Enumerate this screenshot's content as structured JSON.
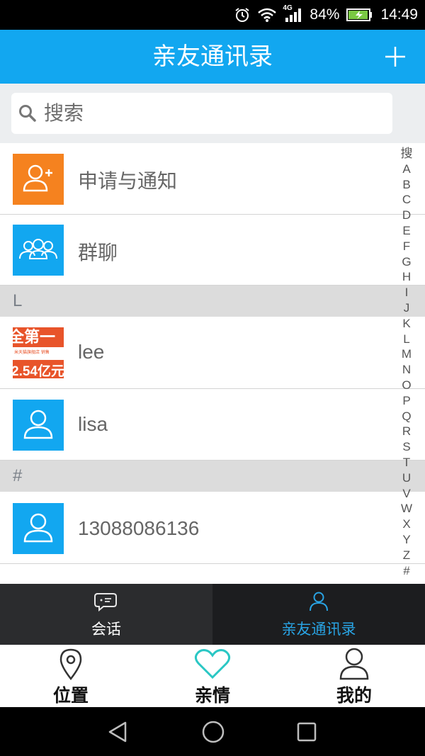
{
  "status_bar": {
    "network": "4G",
    "battery_percent": "84%",
    "time": "14:49"
  },
  "header": {
    "title": "亲友通讯录"
  },
  "search": {
    "placeholder": "搜索"
  },
  "items": [
    {
      "label": "申请与通知"
    },
    {
      "label": "群聊"
    }
  ],
  "sections": [
    {
      "letter": "L",
      "contacts": [
        {
          "name": "lee"
        },
        {
          "name": "lisa"
        }
      ]
    },
    {
      "letter": "#",
      "contacts": [
        {
          "name": "13088086136"
        }
      ]
    }
  ],
  "avatar_thumbnail": {
    "line1": "全第一",
    "line2": "米天猫旗舰店 销售",
    "line3": "2.54亿元"
  },
  "alphabet": [
    "搜",
    "A",
    "B",
    "C",
    "D",
    "E",
    "F",
    "G",
    "H",
    "I",
    "J",
    "K",
    "L",
    "M",
    "N",
    "O",
    "P",
    "Q",
    "R",
    "S",
    "T",
    "U",
    "V",
    "W",
    "X",
    "Y",
    "Z",
    "#"
  ],
  "tabs": [
    {
      "label": "会话"
    },
    {
      "label": "亲友通讯录"
    }
  ],
  "bottom_nav": [
    {
      "label": "位置"
    },
    {
      "label": "亲情"
    },
    {
      "label": "我的"
    }
  ],
  "colors": {
    "accent": "#12a7f0",
    "orange": "#f5821f",
    "tab_active": "#29a3e3",
    "teal": "#2ac7c4"
  }
}
